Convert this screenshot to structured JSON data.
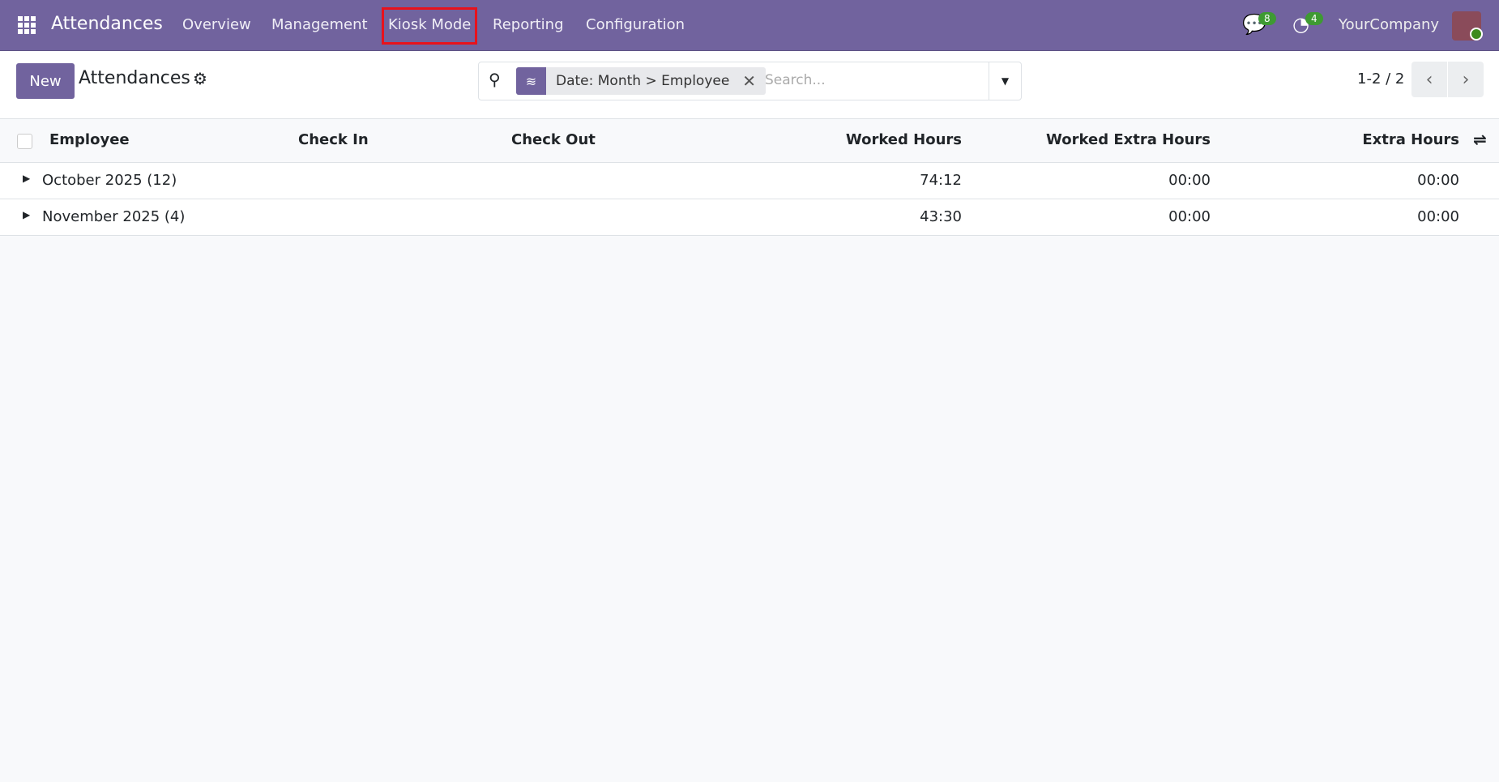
{
  "navbar": {
    "app": "Attendances",
    "menus": [
      "Overview",
      "Management",
      "Kiosk Mode",
      "Reporting",
      "Configuration"
    ],
    "messages_count": "8",
    "activities_count": "4",
    "company": "YourCompany"
  },
  "control": {
    "new_label": "New",
    "title": "Attendances",
    "facet": "Date: Month > Employee",
    "search_placeholder": "Search...",
    "pager": "1-2 / 2"
  },
  "table": {
    "columns": [
      "Employee",
      "Check In",
      "Check Out",
      "Worked Hours",
      "Worked Extra Hours",
      "Extra Hours"
    ],
    "groups": [
      {
        "label": "October 2025 (12)",
        "worked": "74:12",
        "worked_extra": "00:00",
        "extra": "00:00"
      },
      {
        "label": "November 2025 (4)",
        "worked": "43:30",
        "worked_extra": "00:00",
        "extra": "00:00"
      }
    ]
  }
}
